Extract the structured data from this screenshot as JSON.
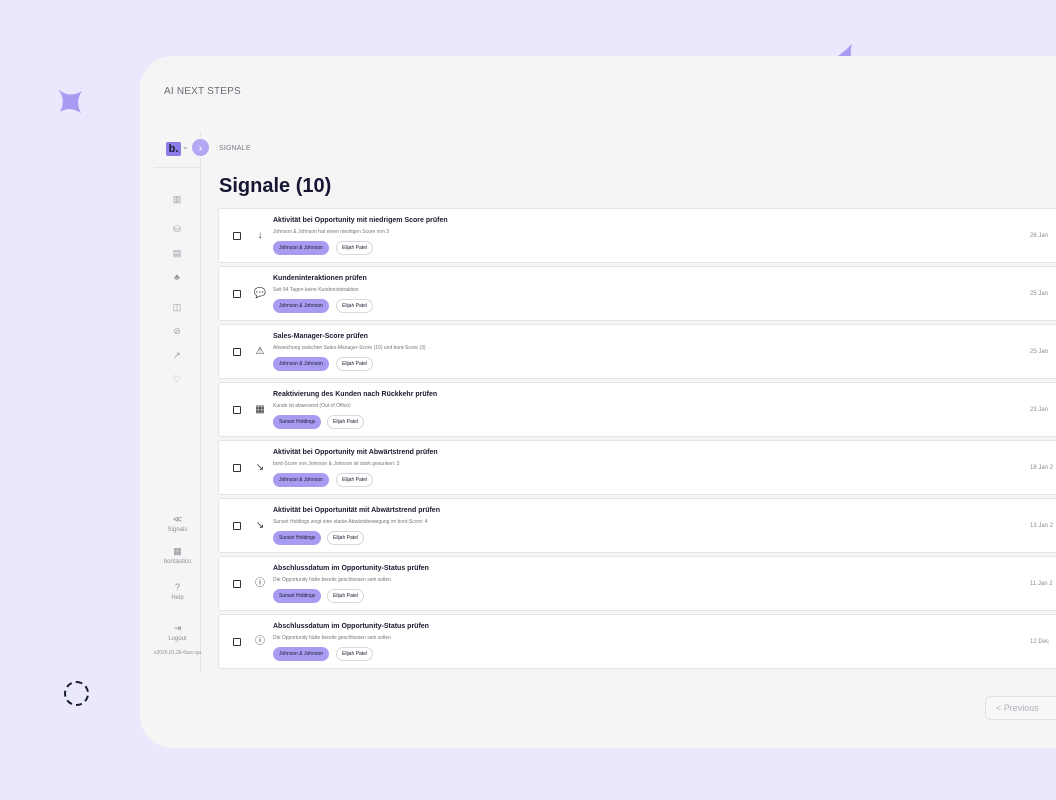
{
  "panel_title": "AI NEXT STEPS",
  "colors": {
    "background": "#eae8fc",
    "accent": "#a89cf2",
    "panel": "#f5f5f6"
  },
  "sidebar": {
    "logo": "b.",
    "expand_icon": "chevron-right-icon",
    "nav_icons": [
      "dashboard-icon",
      "database-icon",
      "document-icon",
      "team-icon",
      "chart-icon",
      "analytics-icon",
      "trend-icon",
      "heart-icon"
    ],
    "bottom": [
      {
        "icon": "signals-icon",
        "label": "Signals"
      },
      {
        "icon": "building-icon",
        "label": "bontastico"
      },
      {
        "icon": "help-icon",
        "label": "Help"
      },
      {
        "icon": "logout-icon",
        "label": "Logout"
      }
    ],
    "version": "v2026.01.26-6acc-qa"
  },
  "breadcrumb": "SIGNALE",
  "page_title": "Signale (10)",
  "signals": [
    {
      "icon": "↓",
      "title": "Aktivität bei Opportunity mit niedrigem Score prüfen",
      "desc": "Johnson & Johnson hat einen niedrigen Score von 3",
      "company": "Johnson & Johnson",
      "person": "Elijah Patel",
      "date": "26 Jan"
    },
    {
      "icon": "💬",
      "title": "Kundeninteraktionen prüfen",
      "desc": "Seit 54 Tagen keine Kundeninteraktion",
      "company": "Johnson & Johnson",
      "person": "Elijah Patel",
      "date": "25 Jan"
    },
    {
      "icon": "⚠",
      "title": "Sales-Manager-Score prüfen",
      "desc": "Abweichung zwischen Sales-Manager-Score (10) und bont-Score (3)",
      "company": "Johnson & Johnson",
      "person": "Elijah Patel",
      "date": "25 Jan"
    },
    {
      "icon": "▦",
      "title": "Reaktivierung des Kunden nach Rückkehr prüfen",
      "desc": "Kunde ist abwesend (Out of Office)",
      "company": "Sunset Holdings",
      "person": "Elijah Patel",
      "date": "23 Jan"
    },
    {
      "icon": "↘",
      "title": "Aktivität bei Opportunity mit Abwärtstrend prüfen",
      "desc": "bont-Score von Johnson & Johnson ist stark gesunken: 3",
      "company": "Johnson & Johnson",
      "person": "Elijah Patel",
      "date": "18 Jan 2"
    },
    {
      "icon": "↘",
      "title": "Aktivität bei Opportunität mit Abwärtstrend prüfen",
      "desc": "Sunset Holdings zeigt eine starke Abwärtsbewegung im bont-Score: 4",
      "company": "Sunset Holdings",
      "person": "Elijah Patel",
      "date": "13 Jan 2"
    },
    {
      "icon": "ⓘ",
      "title": "Abschlussdatum im Opportunity-Status prüfen",
      "desc": "Die Opportunity hätte bereits geschlossen sein sollen",
      "company": "Sunset Holdings",
      "person": "Elijah Patel",
      "date": "11 Jan 2"
    },
    {
      "icon": "ⓘ",
      "title": "Abschlussdatum im Opportunity-Status prüfen",
      "desc": "Die Opportunity hätte bereits geschlossen sein sollen",
      "company": "Johnson & Johnson",
      "person": "Elijah Patel",
      "date": "12 Dec"
    }
  ],
  "pagination": {
    "previous_label": "< Previous"
  }
}
